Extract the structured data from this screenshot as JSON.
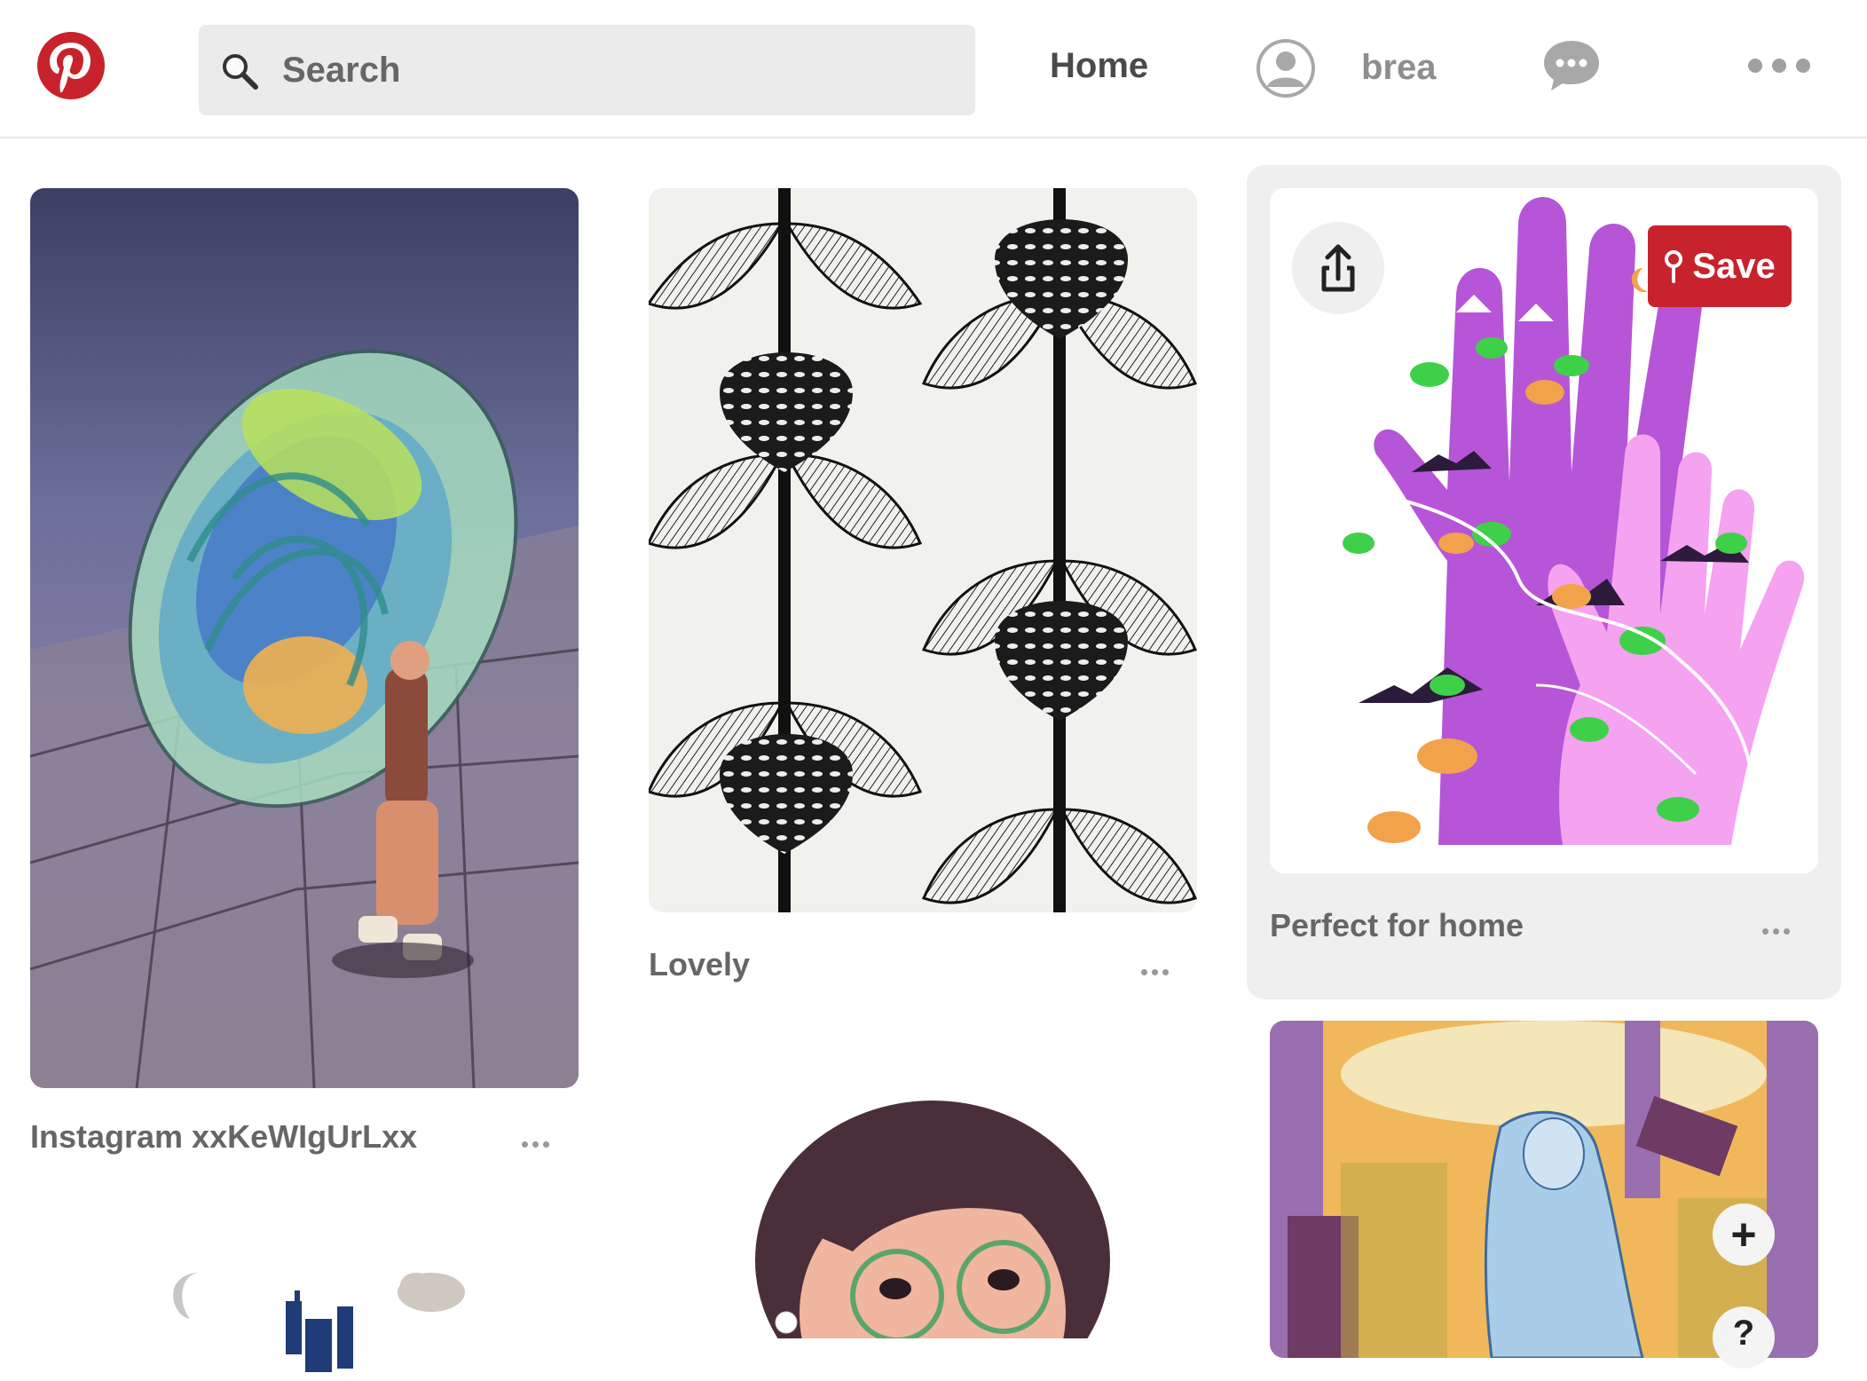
{
  "header": {
    "logo": "pinterest-logo",
    "search": {
      "placeholder": "Search",
      "value": ""
    },
    "nav_home": "Home",
    "user": {
      "name": "brea",
      "avatar_icon": "user-avatar-icon"
    },
    "messages_icon": "chat-bubble-icon",
    "more_icon": "ellipsis-icon"
  },
  "pins": [
    {
      "title": "Instagram xxKeWIgUrLxx",
      "image_desc": "bubble-jellyfish-illustration"
    },
    {
      "title": "Lovely",
      "image_desc": "black-white-leaf-pattern"
    },
    {
      "title": "Perfect for home",
      "image_desc": "purple-hands-landscape",
      "hovered": true,
      "save_label": "Save"
    },
    {
      "title": "",
      "image_desc": "girl-glasses-illustration"
    },
    {
      "title": "",
      "image_desc": "night-castle-illustration"
    },
    {
      "title": "",
      "image_desc": "blue-woman-machines-illustration"
    }
  ],
  "floating": {
    "plus": "+",
    "help": "?"
  },
  "colors": {
    "brand": "#c8232c",
    "text": "#555555",
    "hover_bg": "#efefef"
  }
}
